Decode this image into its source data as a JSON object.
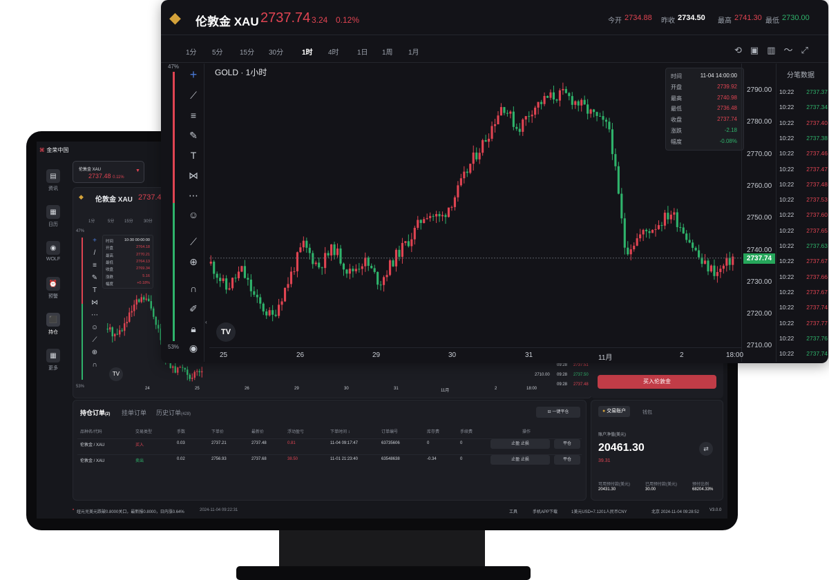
{
  "app": {
    "logo": "金荣中国"
  },
  "sidebar": {
    "items": [
      {
        "label": "资讯",
        "icon": "news-icon"
      },
      {
        "label": "日历",
        "icon": "calendar-icon"
      },
      {
        "label": "WOLF",
        "icon": "wolf-icon"
      },
      {
        "label": "预警",
        "icon": "alarm-icon"
      },
      {
        "label": "持仓",
        "icon": "position-icon"
      },
      {
        "label": "更多",
        "icon": "grid-icon"
      }
    ]
  },
  "small_window": {
    "ticker_card": {
      "name": "伦敦金 XAU",
      "price": "2737.48",
      "change": "0.11%"
    },
    "title": "伦敦金 XAU",
    "price": "2737.4",
    "timeframes": [
      "1分",
      "5分",
      "15分",
      "30分"
    ],
    "pct_top": "47%",
    "pct_bottom": "53%",
    "ohlc": [
      {
        "label": "时间",
        "value": "10-30 00:00:00"
      },
      {
        "label": "开盘",
        "value": "2764.18"
      },
      {
        "label": "最高",
        "value": "2770.21"
      },
      {
        "label": "最低",
        "value": "2764.13"
      },
      {
        "label": "收盘",
        "value": "2769.34"
      },
      {
        "label": "涨跌",
        "value": "5.16"
      },
      {
        "label": "幅度",
        "value": "+0.18%"
      }
    ],
    "x_ticks": [
      "24",
      "25",
      "26",
      "29",
      "30",
      "31",
      "11月",
      "2",
      "18:00"
    ],
    "y_tick": "2710.00",
    "trades": [
      {
        "t": "09:28",
        "p": "2737.51"
      },
      {
        "t": "09:28",
        "p": "2737.50"
      },
      {
        "t": "09:28",
        "p": "2737.48"
      }
    ],
    "buy_button": "买入伦敦金"
  },
  "orders": {
    "tabs": [
      {
        "label": "持仓订单",
        "count": "(2)"
      },
      {
        "label": "挂单订单",
        "count": ""
      },
      {
        "label": "历史订单",
        "count": "(428)"
      }
    ],
    "close_all": "一键平仓",
    "headers": [
      "品种名/代码",
      "交易类型",
      "手数",
      "下单价",
      "最新价",
      "浮动盈亏",
      "下单时间 ↕",
      "订单编号",
      "库存费",
      "手续费",
      "操作"
    ],
    "rows": [
      {
        "symbol": "伦敦金 / XAU",
        "type": "买入",
        "lots": "0.03",
        "open": "2737.21",
        "last": "2737.48",
        "pnl": "0.81",
        "time": "11-04 09:17:47",
        "id": "63735606",
        "swap": "0",
        "fee": "0",
        "tpsl": "止盈 止损",
        "close": "平仓"
      },
      {
        "symbol": "伦敦金 / XAU",
        "type": "卖出",
        "lots": "0.02",
        "open": "2756.93",
        "last": "2737.68",
        "pnl": "38.50",
        "time": "11-01 21:23:40",
        "id": "63548638",
        "swap": "-0.34",
        "fee": "0",
        "tpsl": "止盈 止损",
        "close": "平仓"
      }
    ]
  },
  "account": {
    "tabs": [
      "交易账户",
      "钱包"
    ],
    "label": "账户净值(美元)",
    "equity": "20461.30",
    "pnl": "39.31",
    "stats": [
      {
        "label": "可用预付款(美元)",
        "value": "20431.30"
      },
      {
        "label": "已用预付款(美元)",
        "value": "30.00"
      },
      {
        "label": "预付比例",
        "value": "68204.33%"
      }
    ]
  },
  "status_bar": {
    "news": "纽元兑美元跌破0.8000关口，最新报0.8000，日内涨0.64%",
    "news_time": "2024-11-04 09:22:31",
    "tools": "工具",
    "app_download": "手机APP下载",
    "rate": "1美元USD=7.1201人民币CNY",
    "clock": "北京 2024-11-04 09:28:52",
    "version": "V3.0.0"
  },
  "main_window": {
    "title": "伦敦金 XAU",
    "price": "2737.74",
    "change": "3.24",
    "change_pct": "0.12%",
    "stats": [
      {
        "label": "今开",
        "value": "2734.88"
      },
      {
        "label": "昨收",
        "value": "2734.50"
      },
      {
        "label": "最高",
        "value": "2741.30"
      },
      {
        "label": "最低",
        "value": "2730.00"
      }
    ],
    "timeframes": [
      "1分",
      "5分",
      "15分",
      "30分",
      "1时",
      "4时",
      "1日",
      "1周",
      "1月"
    ],
    "active_timeframe": "1时",
    "chart_label": "GOLD · 1小时",
    "pct_top": "47%",
    "pct_bottom": "53%",
    "ohlc": [
      {
        "label": "时间",
        "value": "11-04 14:00:00"
      },
      {
        "label": "开盘",
        "value": "2739.92"
      },
      {
        "label": "最高",
        "value": "2740.98"
      },
      {
        "label": "最低",
        "value": "2736.48"
      },
      {
        "label": "收盘",
        "value": "2737.74"
      },
      {
        "label": "涨跌",
        "value": "-2.18"
      },
      {
        "label": "幅度",
        "value": "-0.08%"
      }
    ],
    "price_ticks": [
      "2790.00",
      "2780.00",
      "2770.00",
      "2760.00",
      "2750.00",
      "2740.00",
      "2730.00",
      "2720.00",
      "2710.00"
    ],
    "current_price_tag": "2737.74",
    "date_ticks": [
      "25",
      "26",
      "29",
      "30",
      "31",
      "11月",
      "2",
      "18:00"
    ],
    "trades_title": "分笔数据",
    "trades": [
      {
        "t": "10:22",
        "p": "2737.37",
        "c": "g"
      },
      {
        "t": "10:22",
        "p": "2737.34",
        "c": "g"
      },
      {
        "t": "10:22",
        "p": "2737.40",
        "c": "r"
      },
      {
        "t": "10:22",
        "p": "2737.38",
        "c": "g"
      },
      {
        "t": "10:22",
        "p": "2737.46",
        "c": "r"
      },
      {
        "t": "10:22",
        "p": "2737.47",
        "c": "r"
      },
      {
        "t": "10:22",
        "p": "2737.48",
        "c": "r"
      },
      {
        "t": "10:22",
        "p": "2737.53",
        "c": "r"
      },
      {
        "t": "10:22",
        "p": "2737.60",
        "c": "r"
      },
      {
        "t": "10:22",
        "p": "2737.65",
        "c": "r"
      },
      {
        "t": "10:22",
        "p": "2737.63",
        "c": "g"
      },
      {
        "t": "10:22",
        "p": "2737.67",
        "c": "r"
      },
      {
        "t": "10:22",
        "p": "2737.66",
        "c": "r"
      },
      {
        "t": "10:22",
        "p": "2737.67",
        "c": "r"
      },
      {
        "t": "10:22",
        "p": "2737.74",
        "c": "r"
      },
      {
        "t": "10:22",
        "p": "2737.77",
        "c": "r"
      },
      {
        "t": "10:22",
        "p": "2737.76",
        "c": "g"
      },
      {
        "t": "10:22",
        "p": "2737.74",
        "c": "g"
      }
    ]
  }
}
